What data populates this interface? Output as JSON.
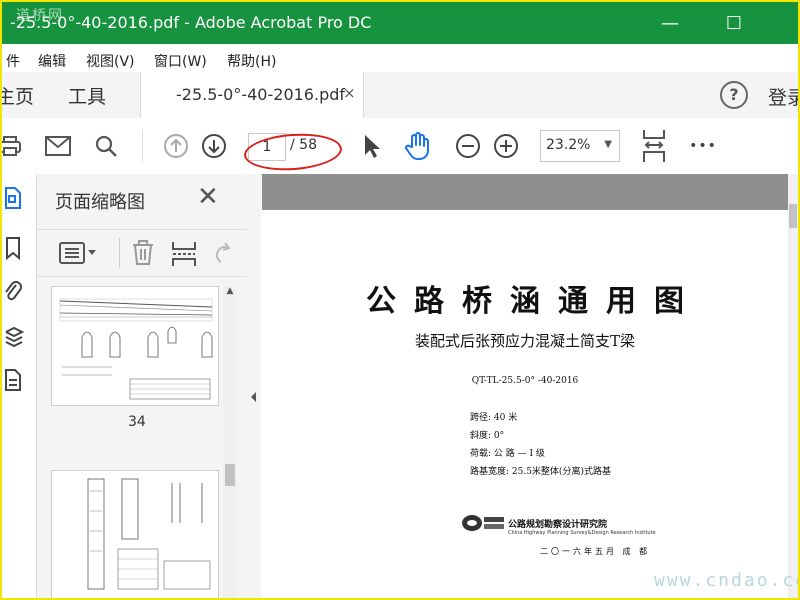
{
  "window": {
    "title": "-25.5-0°-40-2016.pdf - Adobe Acrobat Pro DC",
    "watermark_logo": "道桥网",
    "minimize": "—",
    "maximize": "☐"
  },
  "menu": [
    "件",
    "编辑",
    "视图(V)",
    "窗口(W)",
    "帮助(H)"
  ],
  "tabs": {
    "home": "主页",
    "tools": "工具",
    "document": "-25.5-0°-40-2016.pdf",
    "close": "×"
  },
  "account": {
    "help": "?",
    "login": "登录"
  },
  "toolbar": {
    "page_current": "1",
    "page_total": "/ 58",
    "zoom": "23.2%",
    "more": "•••"
  },
  "panel": {
    "title": "页面缩略图",
    "close": "✕",
    "thumb_labels": [
      "34",
      ""
    ]
  },
  "document": {
    "title": "公路桥涵通用图",
    "subtitle": "装配式后张预应力混凝土简支T梁",
    "code": "QT-TL-25.5-0° -40-2016",
    "span": "跨径:  40 米",
    "skew": "斜度:  0°",
    "load": "荷载:  公 路 — I 级",
    "width": "路基宽度: 25.5米整体(分离)式路基",
    "institute": "公路规划勘察设计研究院",
    "institute_en": "China Highway Planning Survey&Design Research Institute",
    "date": "二〇一六年五月 成 都"
  },
  "watermark": "www.cndao.com",
  "colors": {
    "titlebar": "#17923f",
    "accent_blue": "#1a73e8",
    "highlight_ellipse": "#d9211c",
    "frame": "#f2e600"
  }
}
